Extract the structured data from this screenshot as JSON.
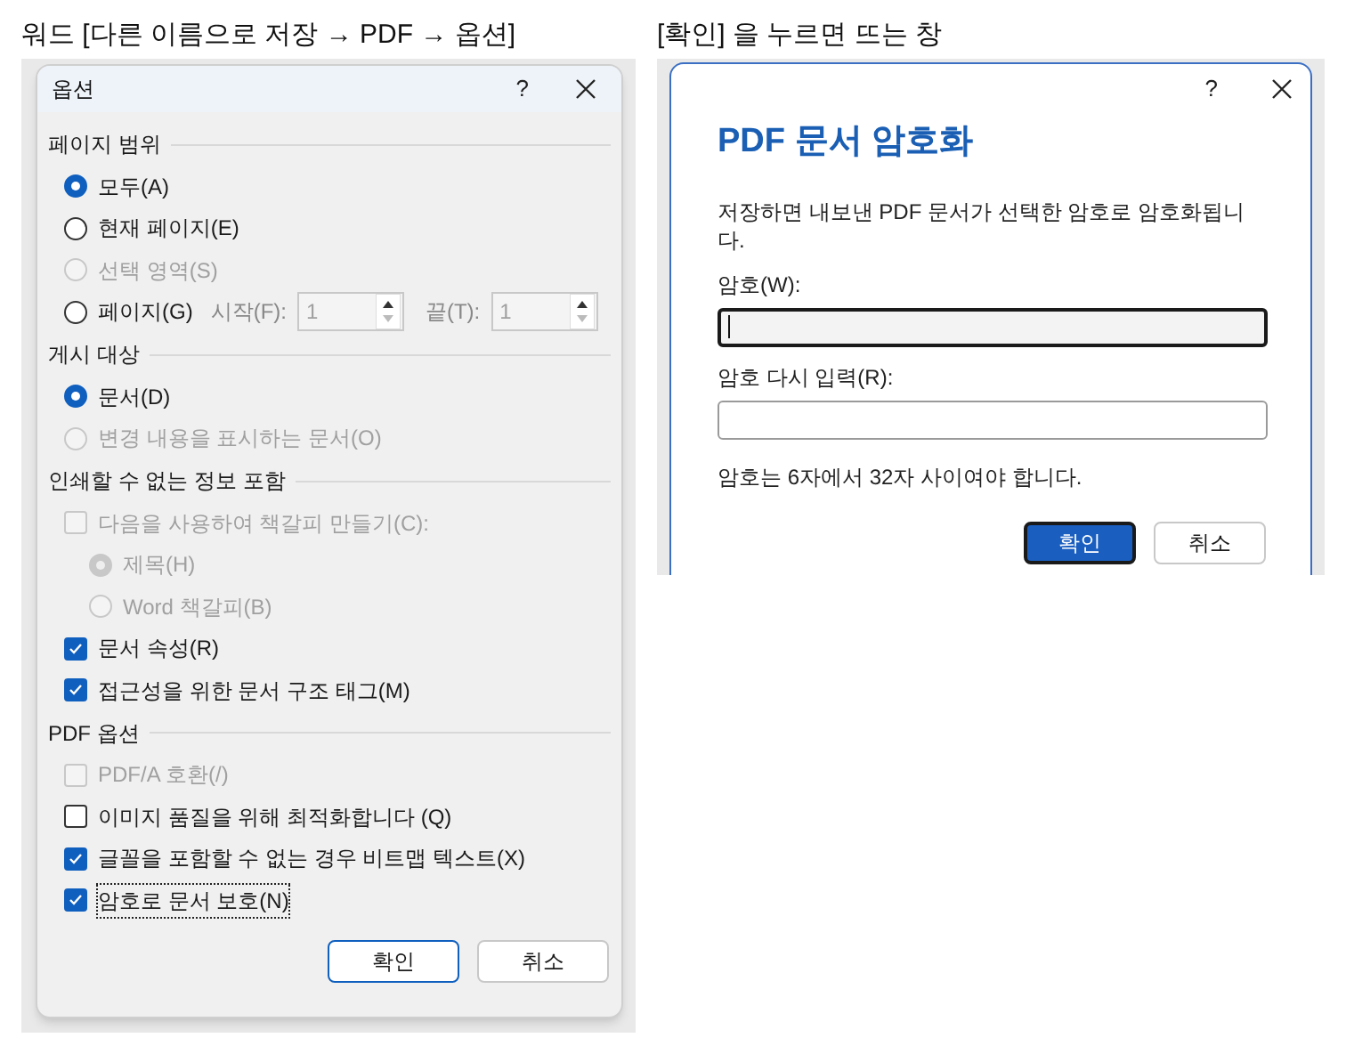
{
  "captions": [
    "워드 [다른 이름으로 저장 → PDF → 옵션]",
    "[확인] 을 누르면 뜨는 창"
  ],
  "options_dialog": {
    "title": "옵션",
    "help": "?",
    "sections": [
      {
        "title": "페이지 범위",
        "items": [
          {
            "kind": "radio",
            "label": "모두(A)",
            "selected": true,
            "disabled": false
          },
          {
            "kind": "radio",
            "label": "현재 페이지(E)",
            "selected": false,
            "disabled": false
          },
          {
            "kind": "radio",
            "label": "선택 영역(S)",
            "selected": false,
            "disabled": true
          },
          {
            "kind": "range",
            "label": "페이지(G)",
            "selected": false,
            "disabled": false,
            "from_label": "시작(F):",
            "from_value": "1",
            "to_label": "끝(T):",
            "to_value": "1"
          }
        ]
      },
      {
        "title": "게시 대상",
        "items": [
          {
            "kind": "radio",
            "label": "문서(D)",
            "selected": true,
            "disabled": false
          },
          {
            "kind": "radio",
            "label": "변경 내용을 표시하는 문서(O)",
            "selected": false,
            "disabled": true
          }
        ]
      },
      {
        "title": "인쇄할 수 없는 정보 포함",
        "items": [
          {
            "kind": "checkbox",
            "label": "다음을 사용하여 책갈피 만들기(C):",
            "checked": false,
            "disabled": true,
            "focused": false,
            "children": [
              {
                "kind": "radio",
                "label": "제목(H)",
                "selected": true,
                "disabled": true
              },
              {
                "kind": "radio",
                "label": "Word 책갈피(B)",
                "selected": false,
                "disabled": true
              }
            ]
          },
          {
            "kind": "checkbox",
            "label": "문서 속성(R)",
            "checked": true,
            "disabled": false,
            "focused": false
          },
          {
            "kind": "checkbox",
            "label": "접근성을 위한 문서 구조 태그(M)",
            "checked": true,
            "disabled": false,
            "focused": false
          }
        ]
      },
      {
        "title": "PDF 옵션",
        "items": [
          {
            "kind": "checkbox",
            "label": "PDF/A 호환(/)",
            "checked": false,
            "disabled": true,
            "focused": false
          },
          {
            "kind": "checkbox",
            "label": "이미지 품질을 위해 최적화합니다 (Q)",
            "checked": false,
            "disabled": false,
            "focused": false
          },
          {
            "kind": "checkbox",
            "label": "글꼴을 포함할 수 없는 경우 비트맵 텍스트(X)",
            "checked": true,
            "disabled": false,
            "focused": false
          },
          {
            "kind": "checkbox",
            "label": "암호로 문서 보호(N)",
            "checked": true,
            "disabled": false,
            "focused": true
          }
        ]
      }
    ],
    "buttons": [
      {
        "label": "확인",
        "default": true
      },
      {
        "label": "취소",
        "default": false
      }
    ]
  },
  "encrypt_dialog": {
    "help": "?",
    "title": "PDF 문서 암호화",
    "description": "저장하면 내보낸 PDF 문서가 선택한 암호로 암호화됩니다.",
    "fields": [
      {
        "label": "암호(W):",
        "focused": true
      },
      {
        "label": "암호 다시 입력(R):",
        "focused": false
      }
    ],
    "note": "암호는 6자에서 32자 사이여야 합니다.",
    "buttons": [
      {
        "label": "확인",
        "default": true
      },
      {
        "label": "취소",
        "default": false
      }
    ]
  }
}
